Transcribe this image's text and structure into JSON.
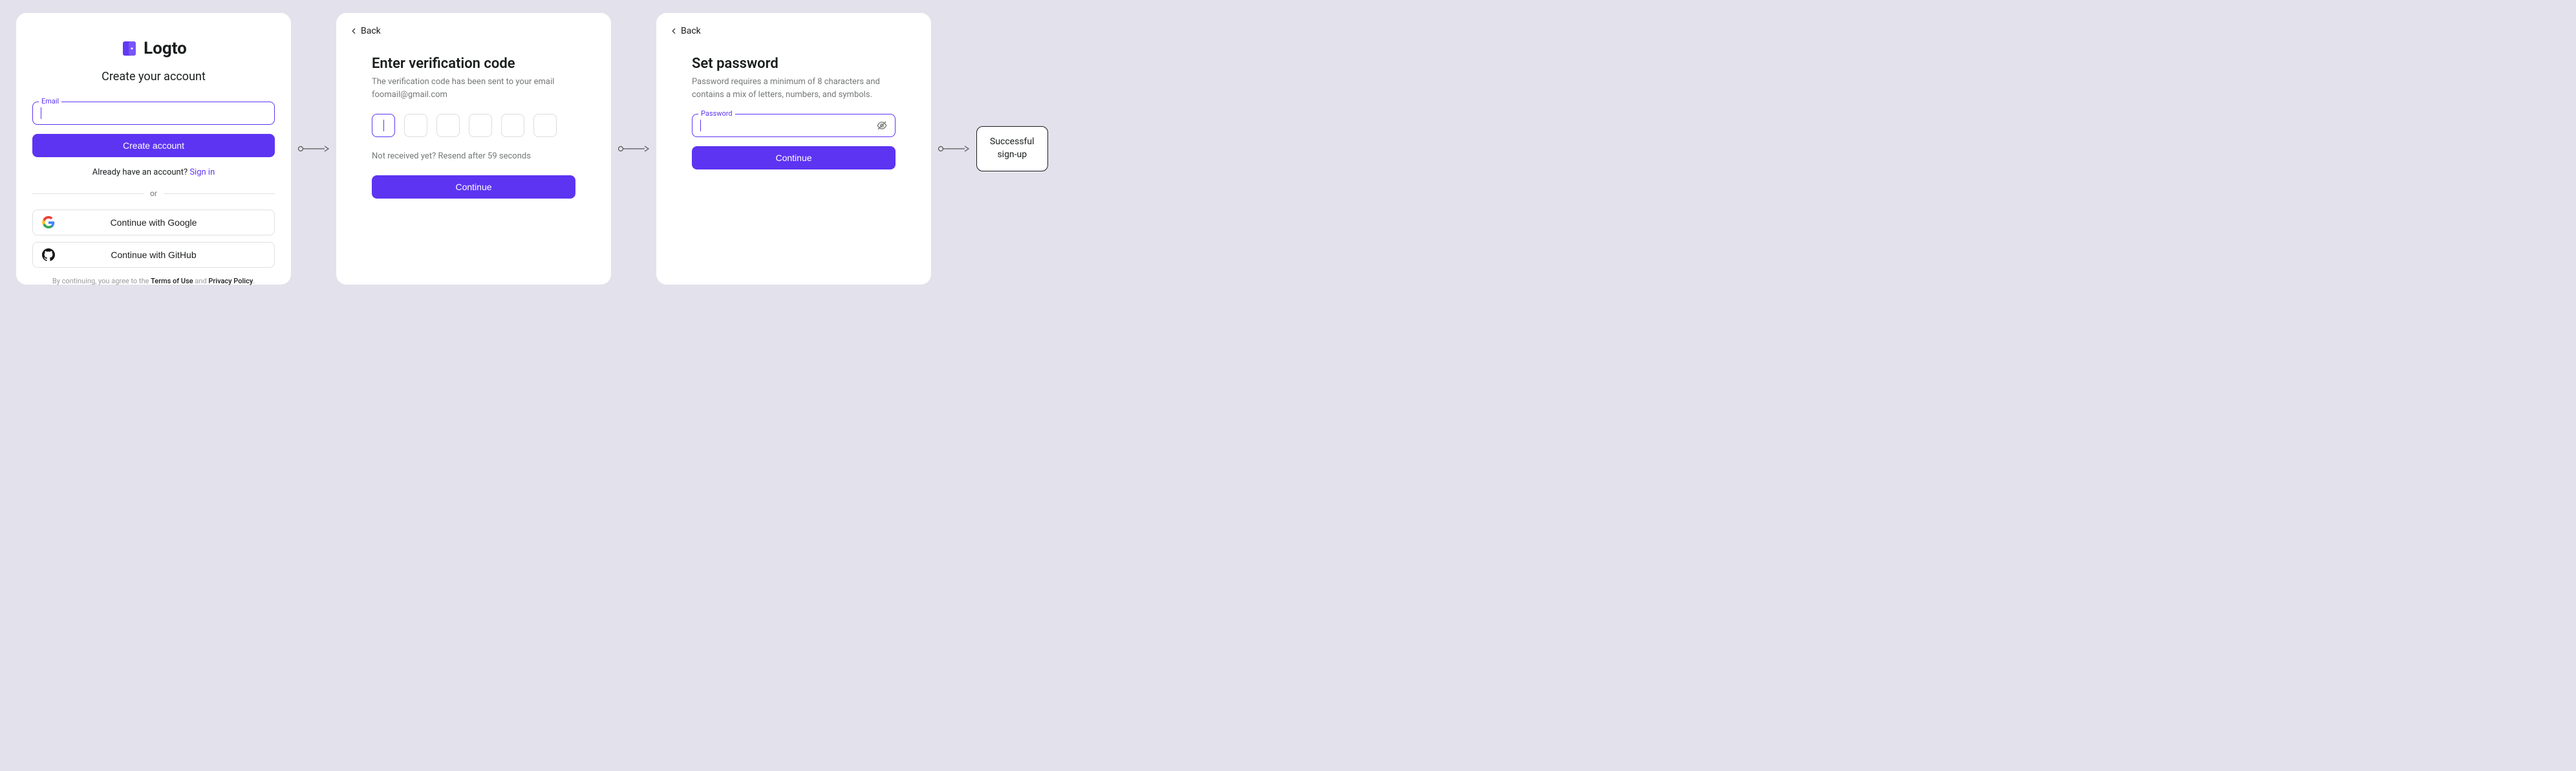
{
  "card1": {
    "logo_text": "Logto",
    "title": "Create your account",
    "email_label": "Email",
    "create_btn": "Create account",
    "switch_prefix": "Already have an account? ",
    "switch_link": "Sign in",
    "divider": "or",
    "google_btn": "Continue with Google",
    "github_btn": "Continue with GitHub",
    "footer_prefix": "By continuing, you agree to the ",
    "footer_terms": "Terms of Use",
    "footer_and": " and ",
    "footer_privacy": "Privacy Policy",
    "footer_suffix": "."
  },
  "card2": {
    "back": "Back",
    "title": "Enter verification code",
    "subtitle_prefix": "The verification code has been sent to your email ",
    "subtitle_email": "foomail@gmail.com",
    "resend": "Not received yet? Resend after 59 seconds",
    "continue_btn": "Continue"
  },
  "card3": {
    "back": "Back",
    "title": "Set password",
    "subtitle": "Password requires a minimum of 8 characters and contains a mix of letters, numbers, and symbols.",
    "password_label": "Password",
    "continue_btn": "Continue"
  },
  "end": {
    "line1": "Successful",
    "line2": "sign-up"
  }
}
